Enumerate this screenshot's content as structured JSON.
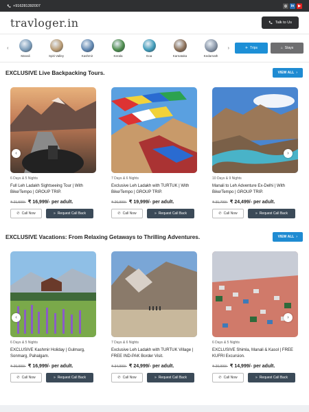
{
  "topbar": {
    "phone": "+916281392007",
    "socials": [
      "insta-icon",
      "linkedin-icon",
      "youtube-icon"
    ]
  },
  "header": {
    "logo": "travloger.in",
    "talk_label": "Talk to Us"
  },
  "destinations": [
    {
      "name": "Manali",
      "color": "#7a9bb8"
    },
    {
      "name": "Spiti Valley",
      "color": "#b89a72"
    },
    {
      "name": "Kashmir",
      "color": "#5f86b0"
    },
    {
      "name": "Kerala",
      "color": "#4b8a4b"
    },
    {
      "name": "Goa",
      "color": "#3e9ab8"
    },
    {
      "name": "Karnataka",
      "color": "#8a6e56"
    },
    {
      "name": "Kedarnath",
      "color": "#8794a6"
    }
  ],
  "trip_buttons": {
    "trips": "Trips",
    "stays": "Stays"
  },
  "sections": [
    {
      "title": "EXCLUSIVE Live Backpacking Tours.",
      "view_all": "VIEW ALL",
      "cards": [
        {
          "days": "6 Days & 5 Nights",
          "title": "Full Leh Ladakh Sightseeing Tour | With Bike/Tempo | GROUP TRIP.",
          "old_price": "₹ 21,599/-",
          "new_price": "₹ 16,999/- per adult.",
          "call": "Call Now",
          "callback": "Request Call Back"
        },
        {
          "days": "7 Days & 6 Nights",
          "title": "Exclusive Leh Ladakh with TURTUK | With Bike/Tempo | GROUP TRIP.",
          "old_price": "₹ 26,999/-",
          "new_price": "₹ 19,999/- per adult.",
          "call": "Call Now",
          "callback": "Request Call Back"
        },
        {
          "days": "10 Days & 9 Nights",
          "title": "Manali to Leh Adventure Ex-Delhi | With Bike/Tempo | GROUP TRIP.",
          "old_price": "₹ 31,799/-",
          "new_price": "₹ 24,499/- per adult.",
          "call": "Call Now",
          "callback": "Request Call Back"
        }
      ]
    },
    {
      "title": "EXCLUSIVE Vacations: From Relaxing Getaways to Thrilling Adventures.",
      "view_all": "VIEW ALL",
      "cards": [
        {
          "days": "6 Days & 5 Nights",
          "title": "EXCLUSIVE Kashmir Holiday | Gulmarg, Sonmarg, Pahalgam.",
          "old_price": "₹ 20,999/-",
          "new_price": "₹ 16,999/- per adult.",
          "call": "Call Now",
          "callback": "Request Call Back"
        },
        {
          "days": "7 Days & 6 Nights",
          "title": "Exclusive Leh Ladakh with TURTUK Village | FREE IND-PAK Border Visit.",
          "old_price": "₹ 34,999/-",
          "new_price": "₹ 24,999/- per adult.",
          "call": "Call Now",
          "callback": "Request Call Back"
        },
        {
          "days": "6 Days & 5 Nights",
          "title": "EXCLUSIVE Shimla, Manali & Kasol | FREE KUFRI Excursion.",
          "old_price": "₹ 20,999/-",
          "new_price": "₹ 14,999/- per adult.",
          "call": "Call Now",
          "callback": "Request Call Back"
        }
      ]
    }
  ]
}
